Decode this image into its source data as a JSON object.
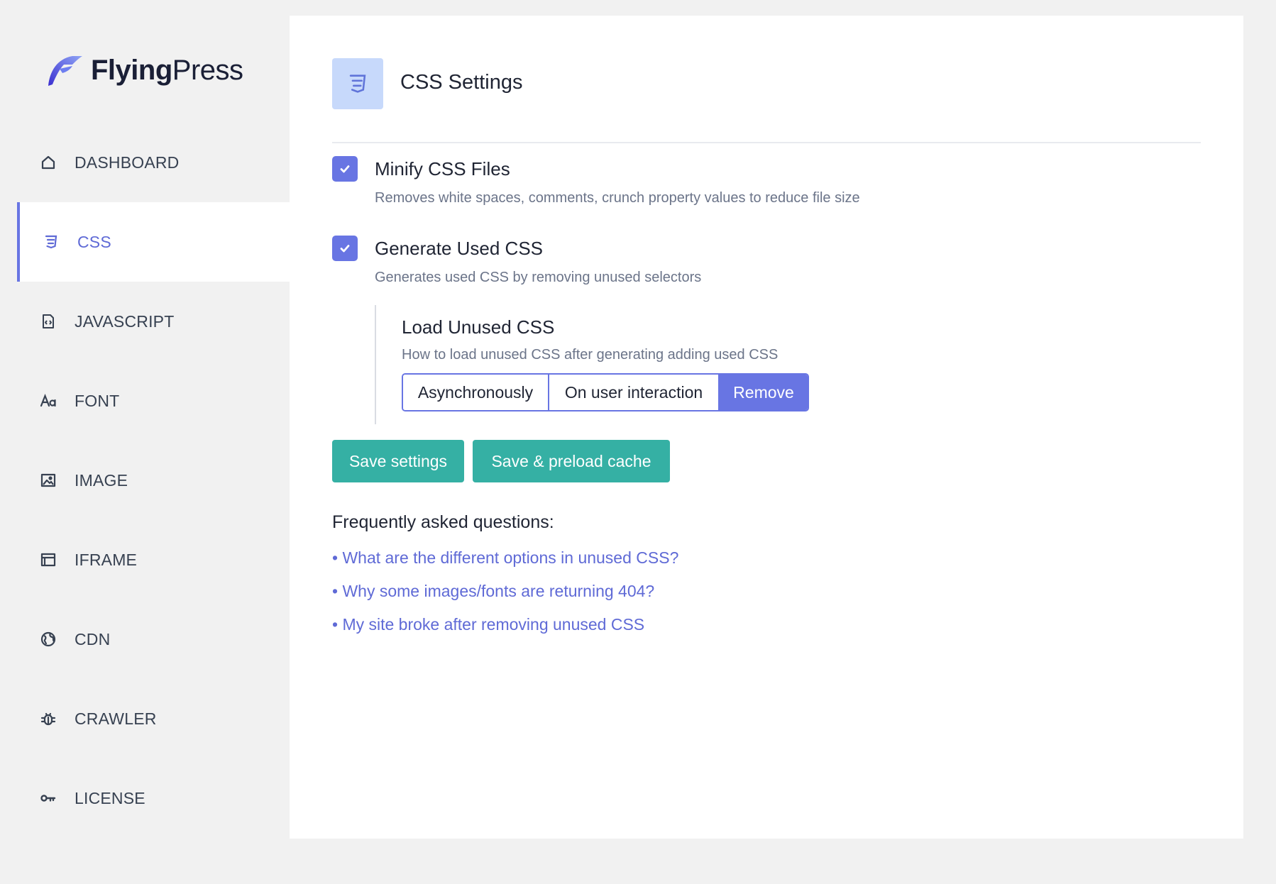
{
  "brand": {
    "name_bold": "Flying",
    "name_light": "Press",
    "accent": "#6875e3",
    "teal": "#35b0a4"
  },
  "sidebar": {
    "items": [
      {
        "label": "DASHBOARD",
        "icon": "home-icon",
        "active": false
      },
      {
        "label": "CSS",
        "icon": "css3-icon",
        "active": true
      },
      {
        "label": "JAVASCRIPT",
        "icon": "code-file-icon",
        "active": false
      },
      {
        "label": "FONT",
        "icon": "font-icon",
        "active": false
      },
      {
        "label": "IMAGE",
        "icon": "image-icon",
        "active": false
      },
      {
        "label": "IFRAME",
        "icon": "browser-window-icon",
        "active": false
      },
      {
        "label": "CDN",
        "icon": "globe-icon",
        "active": false
      },
      {
        "label": "CRAWLER",
        "icon": "bug-icon",
        "active": false
      },
      {
        "label": "LICENSE",
        "icon": "key-icon",
        "active": false
      }
    ]
  },
  "header": {
    "title": "CSS Settings",
    "icon": "css3-icon"
  },
  "settings": {
    "minify": {
      "title": "Minify CSS Files",
      "desc": "Removes white spaces, comments, crunch property values to reduce file size",
      "checked": true
    },
    "used_css": {
      "title": "Generate Used CSS",
      "desc": "Generates used CSS by removing unused selectors",
      "checked": true
    },
    "load_unused": {
      "title": "Load Unused CSS",
      "desc": "How to load unused CSS after generating adding used CSS",
      "options": [
        "Asynchronously",
        "On user interaction",
        "Remove"
      ],
      "selected": "Remove"
    }
  },
  "actions": {
    "save": "Save settings",
    "save_preload": "Save & preload cache"
  },
  "faq": {
    "title": "Frequently asked questions:",
    "links": [
      "• What are the different options in unused CSS?",
      "• Why some images/fonts are returning 404?",
      "• My site broke after removing unused CSS"
    ]
  }
}
